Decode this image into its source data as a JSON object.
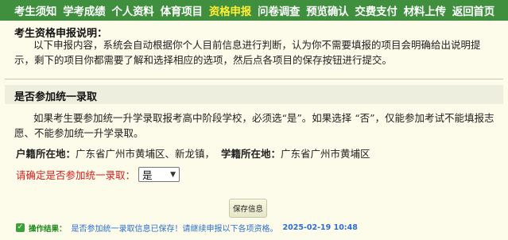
{
  "nav": {
    "items": [
      {
        "label": "考生须知",
        "active": false
      },
      {
        "label": "学考成绩",
        "active": false
      },
      {
        "label": "个人资料",
        "active": false
      },
      {
        "label": "体育项目",
        "active": false
      },
      {
        "label": "资格申报",
        "active": true
      },
      {
        "label": "问卷调查",
        "active": false
      },
      {
        "label": "预览确认",
        "active": false
      },
      {
        "label": "交费支付",
        "active": false
      },
      {
        "label": "材料上传",
        "active": false
      },
      {
        "label": "返回首页",
        "active": false
      }
    ],
    "active_color": "#ffee33",
    "bar_color": "#3f8f3f"
  },
  "instructions": {
    "title": "考生资格申报说明：",
    "text": "以下申报内容，系统会自动根据你个人目前信息进行判断，认为你不需要填报的项目会明确给出说明提示，剩下的项目你都需要了解和选择相应的选项，然后点各项目的保存按钮进行提交。"
  },
  "admission": {
    "title": "是否参加统一录取",
    "text": "如果考生要参加统一升学录取报考高中阶段学校，必须选“是”。如果选择 “否”，仅能参加考试不能填报志愿、不能参加统一升学录取。",
    "household_label": "户籍所在地：",
    "household_value": "广东省广州市黄埔区、新龙镇，",
    "school_label": "学籍所在地：",
    "school_value": "广东省广州市黄埔区",
    "confirm_label": "请确定是否参加统一录取：",
    "confirm_value": "是",
    "save_label": "保存信息"
  },
  "result": {
    "label": "操作结果：",
    "message": "是否参加统一录取信息已保存！请继续申报以下各项资格。",
    "timestamp": "2025-02-19 10:48"
  }
}
